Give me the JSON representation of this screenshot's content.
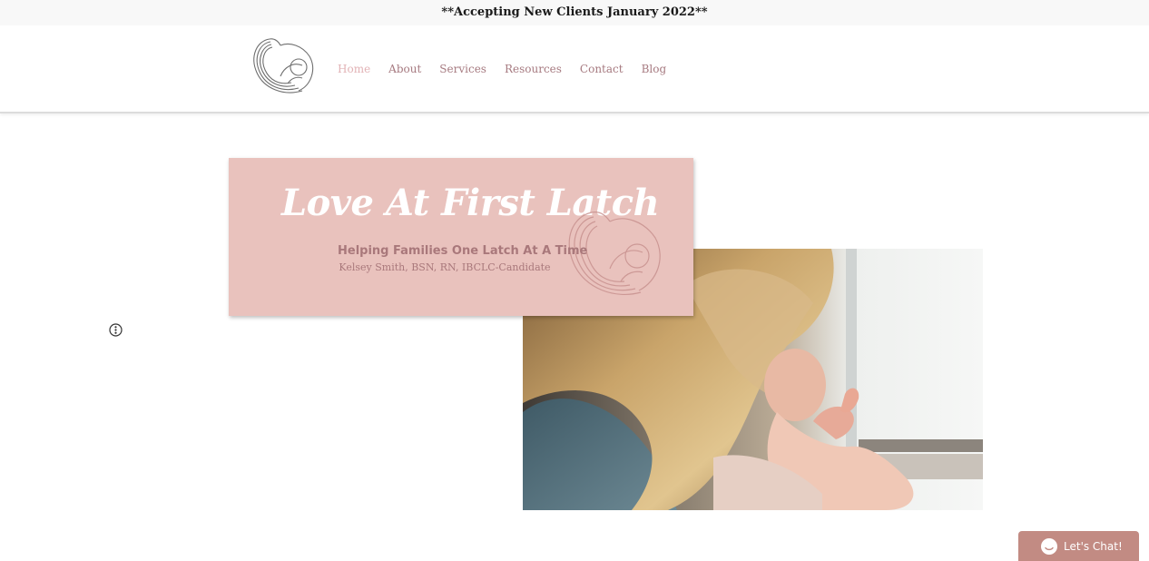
{
  "announcement": "**Accepting New Clients January 2022**",
  "header": {
    "logo_icon": "heart-mother-baby-logo",
    "nav": [
      {
        "label": "Home",
        "active": true
      },
      {
        "label": "About"
      },
      {
        "label": "Services"
      },
      {
        "label": "Resources"
      },
      {
        "label": "Contact"
      },
      {
        "label": "Blog"
      }
    ]
  },
  "hero": {
    "title": "Love At First Latch",
    "tagline": "Helping Families One Latch At A Time",
    "credentials": "Kelsey Smith, BSN, RN, IBCLC-Candidate",
    "watermark_icon": "heart-mother-baby-logo"
  },
  "photo": {
    "subject_icon": "mother-holding-baby-photo"
  },
  "side_menu_icon": "more-vertical-icon",
  "chat": {
    "label": "Let's Chat!",
    "icon": "chat-face-icon"
  },
  "colors": {
    "nav_text": "#a67a80",
    "nav_active": "#e2b3b6",
    "hero_bg": "#e9c2bd",
    "hero_text": "#a9787b",
    "chat_bg": "#c28b83"
  }
}
